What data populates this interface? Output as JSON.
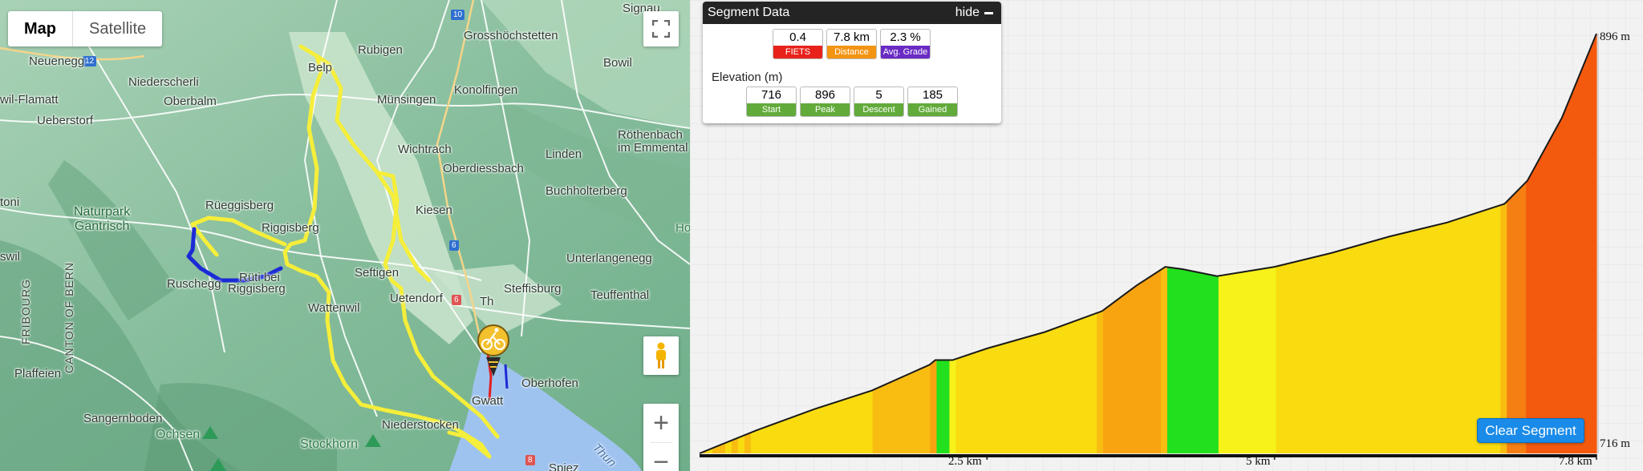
{
  "map": {
    "type_control": {
      "map_label": "Map",
      "satellite_label": "Satellite"
    },
    "labels": {
      "signau": "Signau",
      "neuenegg": "Neuenegg",
      "rubigen": "Rubigen",
      "grosshoechstetten": "Grosshöchstetten",
      "bowil": "Bowil",
      "niederscherli": "Niederscherli",
      "belp": "Belp",
      "muensingen": "Münsingen",
      "konolfingen": "Konolfingen",
      "wil_flamatt": "wil-Flamatt",
      "oberbalm": "Oberbalm",
      "ueberstorf": "Ueberstorf",
      "wichtrach": "Wichtrach",
      "oberdiessbach": "Oberdiessbach",
      "linden": "Linden",
      "roethenbach": "Röthenbach",
      "im_emmental": "im Emmental",
      "buchholterberg": "Buchholterberg",
      "toni": "toni",
      "rueggisberg": "Rüeggisberg",
      "riggisberg": "Riggisberg",
      "kiesen": "Kiesen",
      "naturpark": "Naturpark",
      "gantrisch": "Gantrisch",
      "swil": "swil",
      "unterlangenegg": "Unterlangenegg",
      "ruschegg": "Ruschegg",
      "ruetiby": "Rüti bei",
      "riggisberg2": "Riggisberg",
      "seftigen": "Seftigen",
      "steffisburg": "Steffisburg",
      "teuffenthal": "Teuffenthal",
      "wattenwil": "Wattenwil",
      "uetendorf": "Uetendorf",
      "canton_fribourg": "FRIBOURG",
      "canton_bern": "CANTON OF BERN",
      "plaffeien": "Plaffeien",
      "oberhofen": "Oberhofen",
      "gwatt": "Gwatt",
      "sangernboden": "Sangernboden",
      "ochsen": "Ochsen",
      "stockhorn": "Stockhorn",
      "niederstocken": "Niederstocken",
      "thun_lake": "Thun",
      "spiez": "Spiez",
      "ho": "Ho",
      "th": "Th"
    },
    "roads": {
      "r10": "10",
      "r12": "12",
      "r6a": "6",
      "r6b": "6",
      "r8": "8"
    },
    "colors": {
      "route": "#f5ee3a",
      "segment": "#1c2ad6",
      "lake": "#9fc3ef"
    }
  },
  "segment": {
    "header": "Segment Data",
    "hide_label": "hide",
    "stats": [
      {
        "value": "0.4",
        "label": "FIETS",
        "color": "#e8221b"
      },
      {
        "value": "7.8 km",
        "label": "Distance",
        "color": "#f39412"
      },
      {
        "value": "2.3 %",
        "label": "Avg. Grade",
        "color": "#6a2bc4"
      }
    ],
    "elevation_title": "Elevation (m)",
    "elevation_stats": [
      {
        "value": "716",
        "label": "Start",
        "color": "#62ab3a"
      },
      {
        "value": "896",
        "label": "Peak",
        "color": "#62ab3a"
      },
      {
        "value": "5",
        "label": "Descent",
        "color": "#62ab3a"
      },
      {
        "value": "185",
        "label": "Gained",
        "color": "#62ab3a"
      }
    ]
  },
  "profile": {
    "clear_label": "Clear Segment",
    "y_top_label": "896 m",
    "y_bottom_label": "716 m",
    "x_labels": [
      "2.5 km",
      "5 km",
      "7.8 km"
    ]
  },
  "chart_data": {
    "type": "area",
    "x_unit": "km",
    "y_unit": "m",
    "xlim": [
      0,
      7.8
    ],
    "ylim": [
      716,
      896
    ],
    "x": [
      0,
      0.5,
      1.0,
      1.5,
      2.0,
      2.05,
      2.2,
      2.5,
      3.0,
      3.5,
      3.8,
      4.05,
      4.2,
      4.5,
      5.0,
      5.5,
      6.0,
      6.5,
      7.0,
      7.2,
      7.5,
      7.8
    ],
    "y": [
      716,
      726,
      735,
      743,
      754,
      756,
      756,
      761,
      768,
      777,
      788,
      796,
      795,
      792,
      796,
      802,
      809,
      815,
      823,
      833,
      860,
      896
    ],
    "x_tick_labels": [
      "2.5 km",
      "5 km",
      "7.8 km"
    ],
    "y_tick_labels": [
      "896 m",
      "716 m"
    ]
  }
}
